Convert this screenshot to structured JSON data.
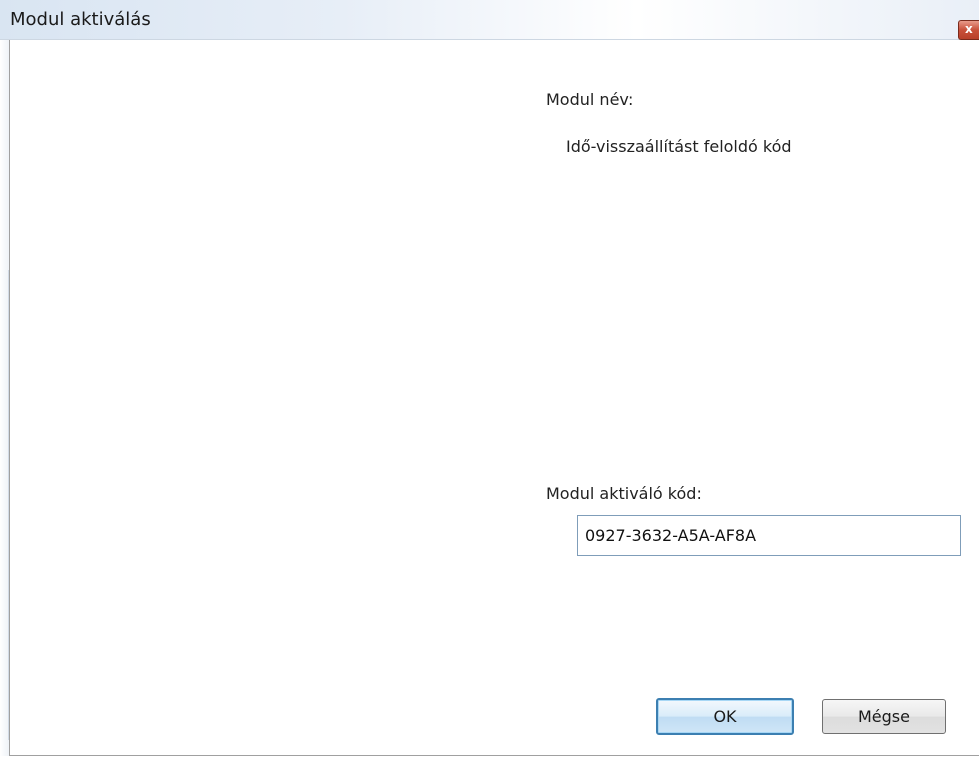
{
  "window": {
    "title": "Modul aktiválás",
    "close_glyph": "x"
  },
  "module": {
    "name_label": "Modul név:",
    "name_value": "Idő-visszaállítást feloldó kód",
    "code_label": "Modul aktiváló kód:",
    "code_value": "0927-3632-A5A-AF8A"
  },
  "buttons": {
    "ok_label": "OK",
    "cancel_label": "Mégse"
  },
  "colors": {
    "ok_border": "#3c7fb1",
    "close_button": "#c8503a",
    "input_border": "#7f9db9"
  }
}
